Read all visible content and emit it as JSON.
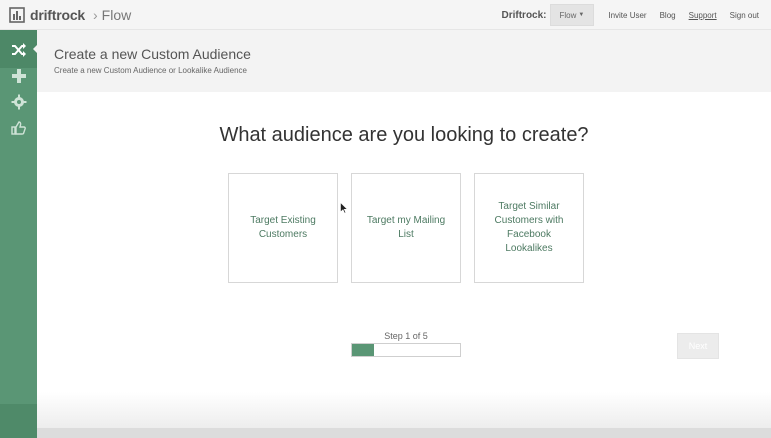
{
  "topbar": {
    "brand": "driftrock",
    "product": "Flow",
    "account_label": "Driftrock:",
    "flow_dropdown": "Flow",
    "links": [
      "Invite User",
      "Blog",
      "Support",
      "Sign out"
    ]
  },
  "sidebar": {
    "icons": [
      "shuffle-icon",
      "plus-icon",
      "gear-icon",
      "thumbs-up-icon"
    ]
  },
  "header": {
    "title": "Create a new Custom Audience",
    "subtitle": "Create a new Custom Audience or Lookalike Audience"
  },
  "main": {
    "question": "What audience are you looking to create?",
    "options": [
      "Target Existing Customers",
      "Target my Mailing List",
      "Target Similar Customers with Facebook Lookalikes"
    ],
    "step": {
      "label": "Step 1 of 5",
      "current": 1,
      "total": 5
    },
    "next_label": "Next"
  },
  "colors": {
    "accent": "#5a9675",
    "accent_dark": "#4d8867",
    "option_text": "#4d7a62"
  }
}
